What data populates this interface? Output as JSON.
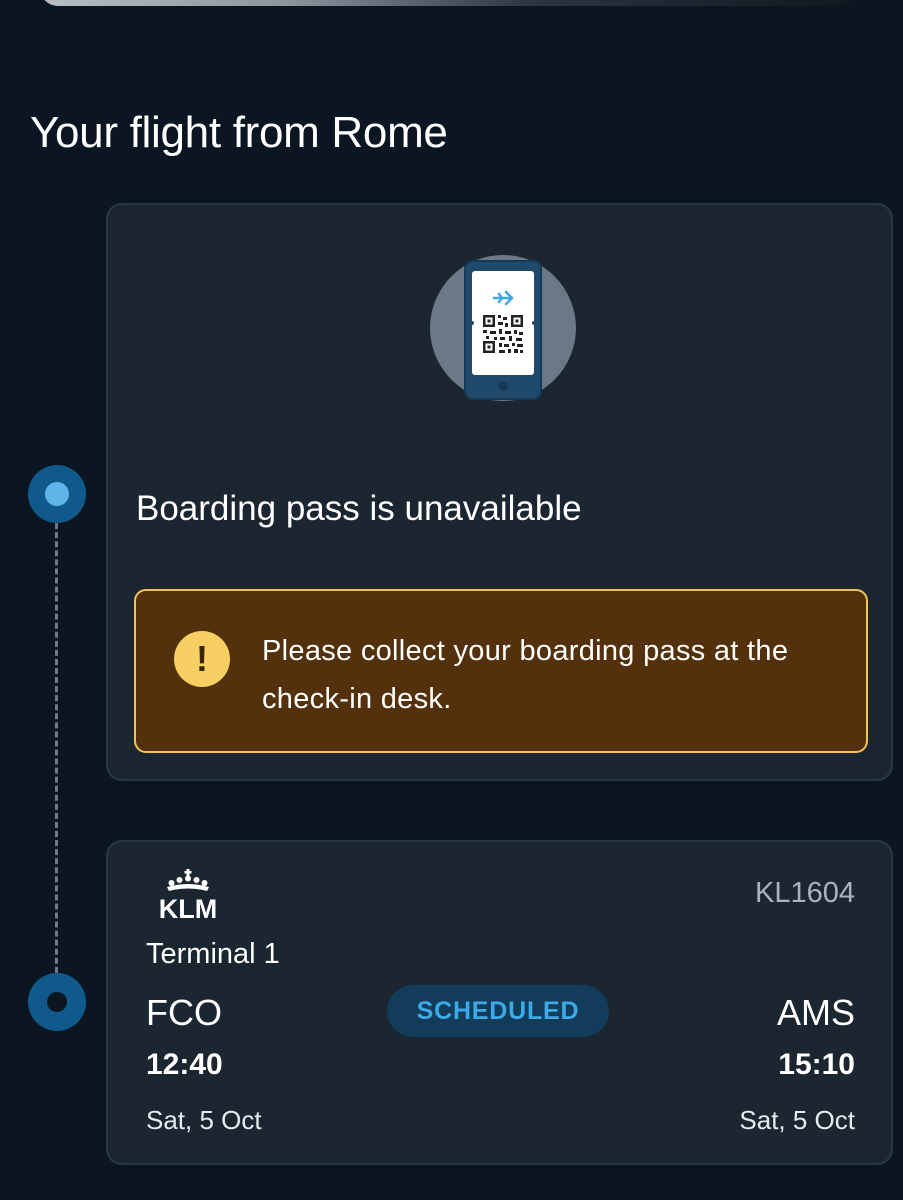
{
  "page": {
    "title": "Your flight from Rome"
  },
  "boarding_pass": {
    "title": "Boarding pass is unavailable",
    "illustration_icon": "phone-boarding-pass-qr-icon",
    "alert": {
      "icon": "exclamation-icon",
      "message": "Please collect your boarding pass at the check-in desk."
    }
  },
  "flight": {
    "airline_logo_text": "KLM",
    "flight_number": "KL1604",
    "terminal": "Terminal 1",
    "status": "SCHEDULED",
    "origin": {
      "code": "FCO",
      "time": "12:40",
      "date": "Sat, 5 Oct"
    },
    "destination": {
      "code": "AMS",
      "time": "15:10",
      "date": "Sat, 5 Oct"
    }
  },
  "colors": {
    "background": "#0b1622",
    "card": "#1b2631",
    "alert_background": "#52310c",
    "alert_border": "#f3c35a",
    "accent_blue": "#3da9e8",
    "timeline_dot": "#0f5a8a"
  }
}
